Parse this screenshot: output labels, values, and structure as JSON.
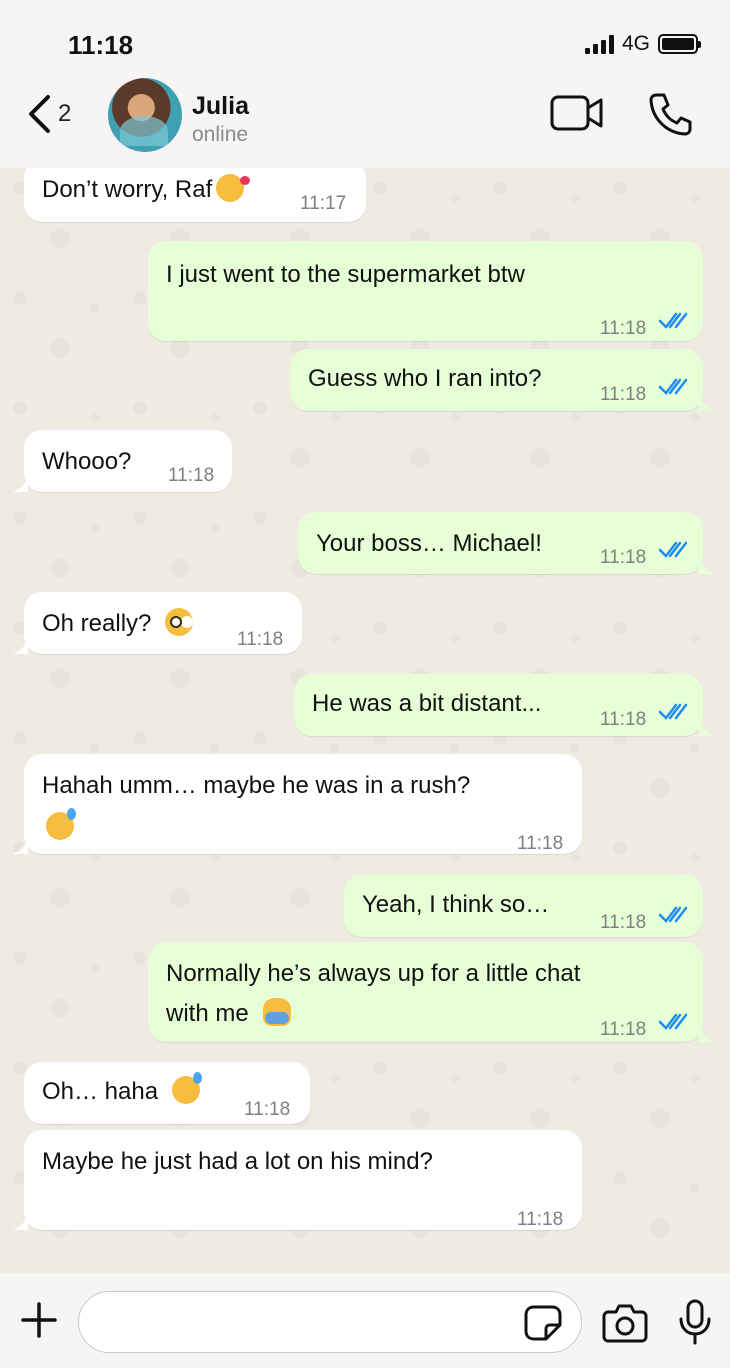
{
  "status_bar": {
    "time": "11:18",
    "network": "4G"
  },
  "header": {
    "back_count": "2",
    "contact_name": "Julia",
    "contact_status": "online",
    "icons": [
      "chevron-left-icon",
      "video-camera-icon",
      "phone-icon"
    ]
  },
  "messages": [
    {
      "direction": "in",
      "text": "Don’t worry, Raf",
      "emoji": "kissing-heart",
      "time": "11:17"
    },
    {
      "direction": "out",
      "text": "I just went to the supermarket btw",
      "time": "11:18",
      "status": "read"
    },
    {
      "direction": "out",
      "text": "Guess who I ran into?",
      "time": "11:18",
      "status": "read"
    },
    {
      "direction": "in",
      "text": "Whooo?",
      "time": "11:18"
    },
    {
      "direction": "out",
      "text": "Your boss… Michael!",
      "time": "11:18",
      "status": "read"
    },
    {
      "direction": "in",
      "text": "Oh really?",
      "emoji": "flushed",
      "time": "11:18"
    },
    {
      "direction": "out",
      "text": "He was a bit distant...",
      "time": "11:18",
      "status": "read"
    },
    {
      "direction": "in",
      "text": "Hahah umm… maybe he was in a rush?",
      "emoji": "grinning-sweat",
      "time": "11:18"
    },
    {
      "direction": "out",
      "text": "Yeah, I think so…",
      "time": "11:18",
      "status": "read"
    },
    {
      "direction": "out",
      "text_line1": "Normally he’s always up for a little chat",
      "text_line2": "with me",
      "emoji": "person-shrugging",
      "time": "11:18",
      "status": "read"
    },
    {
      "direction": "in",
      "text": "Oh… haha",
      "emoji": "grinning-sweat",
      "time": "11:18"
    },
    {
      "direction": "in",
      "text": "Maybe he just had a lot on his mind?",
      "time": "11:18"
    }
  ],
  "input_bar": {
    "placeholder": "",
    "icons": [
      "plus-icon",
      "sticker-icon",
      "camera-icon",
      "microphone-icon"
    ]
  },
  "colors": {
    "incoming_bubble": "#ffffff",
    "outgoing_bubble": "#e6ffd6",
    "read_ticks": "#1d8cf8",
    "chat_background": "#efeae2"
  }
}
